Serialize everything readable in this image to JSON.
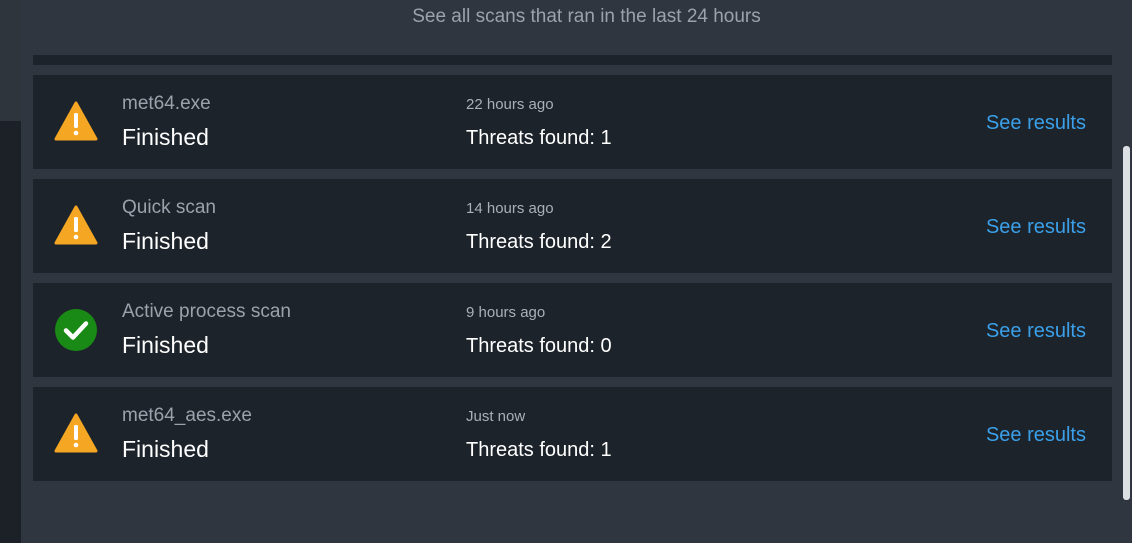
{
  "header": {
    "subtitle": "See all scans that ran in the last 24 hours"
  },
  "colors": {
    "background": "#30363f",
    "row_background": "#1d232a",
    "warning": "#f5a623",
    "success": "#1a8a16",
    "link": "#3aa0ea"
  },
  "scans": [
    {
      "icon": "warning-icon",
      "name": "met64.exe",
      "status": "Finished",
      "time": "22 hours ago",
      "threats": "Threats found: 1",
      "link": "See results"
    },
    {
      "icon": "warning-icon",
      "name": "Quick scan",
      "status": "Finished",
      "time": "14 hours ago",
      "threats": "Threats found: 2",
      "link": "See results"
    },
    {
      "icon": "check-circle-icon",
      "name": "Active process scan",
      "status": "Finished",
      "time": "9 hours ago",
      "threats": "Threats found: 0",
      "link": "See results"
    },
    {
      "icon": "warning-icon",
      "name": "met64_aes.exe",
      "status": "Finished",
      "time": "Just now",
      "threats": "Threats found: 1",
      "link": "See results"
    }
  ]
}
